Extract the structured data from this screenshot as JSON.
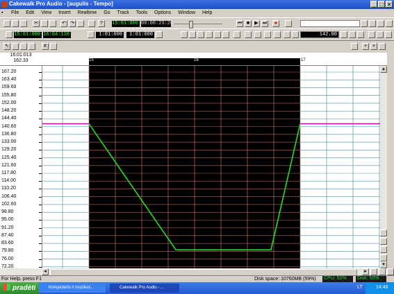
{
  "window": {
    "title": "Cakewalk Pro Audio - [augulis - Tempo]"
  },
  "menu": [
    "File",
    "Edit",
    "View",
    "Insert",
    "Realtime",
    "Go",
    "Track",
    "Tools",
    "Options",
    "Window",
    "Help"
  ],
  "transport": {
    "now_time": "15:01:000",
    "smpte": "00:00:23:20"
  },
  "toolbar2": {
    "from": "15:01:000",
    "thru": "16:04:110",
    "loop_from": "1:01:000",
    "loop_thru": "1:01:000",
    "tempo": "142.00"
  },
  "tempo_view": {
    "position_time": "16:01:013",
    "position_tempo": "162.33",
    "ruler_marks": [
      "15",
      "16",
      "17"
    ],
    "y_labels": [
      "167.20",
      "163.40",
      "159.60",
      "155.80",
      "152.00",
      "148.20",
      "144.40",
      "140.60",
      "136.80",
      "133.00",
      "129.20",
      "125.40",
      "121.60",
      "117.80",
      "114.00",
      "110.20",
      "106.40",
      "102.60",
      "98.80",
      "95.00",
      "91.20",
      "87.40",
      "83.60",
      "79.80",
      "76.00",
      "72.20"
    ],
    "selection_color": "#000000",
    "grid_selected_color": "#c46a6a",
    "grid_color": "#4a8fa0",
    "tempo_line_color": "#22e022",
    "boundary_tempo_color": "#d000d0"
  },
  "status": {
    "help": "For Help, press F1",
    "disk": "Disk space: 10760MB (59%)",
    "cpu": "CPU: 50%",
    "disk_meter": "Disk: 50%"
  },
  "taskbar": {
    "start": "pradėti",
    "task1": "Kompiuteris ir muzikos...",
    "task2": "Cakewalk Pro Audio - ...",
    "lang": "LT",
    "clock": "14:46"
  }
}
